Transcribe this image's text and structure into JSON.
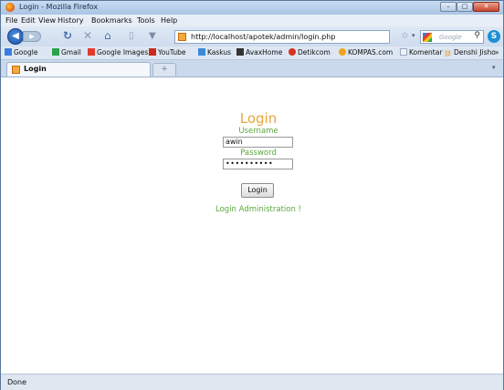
{
  "window": {
    "title": "Login - Mozilla Firefox",
    "controls": {
      "minimize": "–",
      "maximize": "□",
      "close": "✕"
    }
  },
  "menu": [
    "File",
    "Edit",
    "View",
    "History",
    "Bookmarks",
    "Tools",
    "Help"
  ],
  "nav": {
    "url": "http://localhost/apotek/admin/login.php",
    "search_placeholder": "Google",
    "icons": {
      "back": "back-arrow-icon",
      "forward": "forward-arrow-icon",
      "reload": "reload-icon",
      "stop": "stop-icon",
      "home": "home-icon"
    }
  },
  "bookmarks": [
    "Google",
    "Gmail",
    "Google Images",
    "YouTube",
    "Kaskus",
    "AvaxHome",
    "Detikcom",
    "KOMPAS.com",
    "Komentar",
    "Denshi Jisho"
  ],
  "tab": {
    "label": "Login",
    "new_tab": "+"
  },
  "page": {
    "heading": "Login",
    "username_label": "Username",
    "username_value": "awin",
    "password_label": "Password",
    "password_value": "••••••••••",
    "submit": "Login",
    "admin_link": "Login Administration !"
  },
  "status": "Done",
  "colors": {
    "heading": "#e8a53a",
    "label": "#5aa73b"
  }
}
